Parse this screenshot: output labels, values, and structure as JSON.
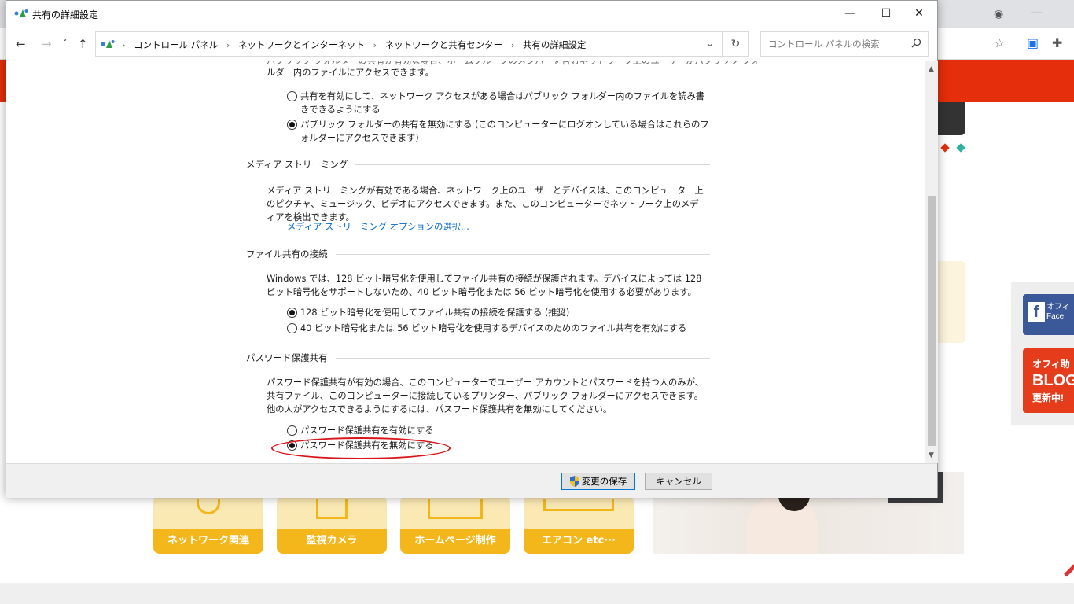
{
  "window": {
    "title": "共有の詳細設定",
    "minimize_glyph": "—",
    "maximize_glyph": "☐",
    "close_glyph": "✕"
  },
  "address_bar": {
    "back_glyph": "←",
    "forward_glyph": "→",
    "recent_glyph": "˅",
    "up_glyph": "↑",
    "breadcrumbs": [
      "コントロール パネル",
      "ネットワークとインターネット",
      "ネットワークと共有センター",
      "共有の詳細設定"
    ],
    "separator": "›",
    "dropdown_glyph": "⌄",
    "refresh_glyph": "↻"
  },
  "search": {
    "placeholder": "コントロール パネルの検索",
    "icon": "search-icon"
  },
  "public_folder": {
    "partial_line1": "パブリック フォルダーの共有が有効な場合、ホームグループのメンバーを含むネットワーク上のユーザーがパブリック フォ",
    "partial_line2": "ルダー内のファイルにアクセスできます。",
    "option_enable": "共有を有効にして、ネットワーク アクセスがある場合はパブリック フォルダー内のファイルを読み書きできるようにする",
    "option_disable": "パブリック フォルダーの共有を無効にする (このコンピューターにログオンしている場合はこれらのフォルダーにアクセスできます)",
    "selected": "disable"
  },
  "media_streaming": {
    "heading": "メディア ストリーミング",
    "description": "メディア ストリーミングが有効である場合、ネットワーク上のユーザーとデバイスは、このコンピューター上のピクチャ、ミュージック、ビデオにアクセスできます。また、このコンピューターでネットワーク上のメディアを検出できます。",
    "link": "メディア ストリーミング オプションの選択..."
  },
  "file_sharing": {
    "heading": "ファイル共有の接続",
    "description": "Windows では、128 ビット暗号化を使用してファイル共有の接続が保護されます。デバイスによっては 128 ビット暗号化をサポートしないため、40 ビット暗号化または 56 ビット暗号化を使用する必要があります。",
    "option_128": "128 ビット暗号化を使用してファイル共有の接続を保護する (推奨)",
    "option_40_56": "40 ビット暗号化または 56 ビット暗号化を使用するデバイスのためのファイル共有を有効にする",
    "selected": "128"
  },
  "password_sharing": {
    "heading": "パスワード保護共有",
    "description": "パスワード保護共有が有効の場合、このコンピューターでユーザー アカウントとパスワードを持つ人のみが、共有ファイル、このコンピューターに接続しているプリンター、パブリック フォルダーにアクセスできます。他の人がアクセスできるようにするには、パスワード保護共有を無効にしてください。",
    "option_enable": "パスワード保護共有を有効にする",
    "option_disable": "パスワード保護共有を無効にする",
    "selected": "disable",
    "highlight_color": "#d8151a"
  },
  "buttons": {
    "save": "変更の保存",
    "cancel": "キャンセル"
  },
  "background_page": {
    "fb_label_line1": "オフィ",
    "fb_label_line2": "Face",
    "blog_line1": "オフィ助",
    "blog_line2": "BLOG",
    "blog_line3": "更新中!",
    "categories": [
      "ネットワーク関連",
      "監視カメラ",
      "ホームページ制作",
      "エアコン etc···"
    ],
    "accent_red": "#e42e0c",
    "accent_yellow": "#f3b71c"
  }
}
